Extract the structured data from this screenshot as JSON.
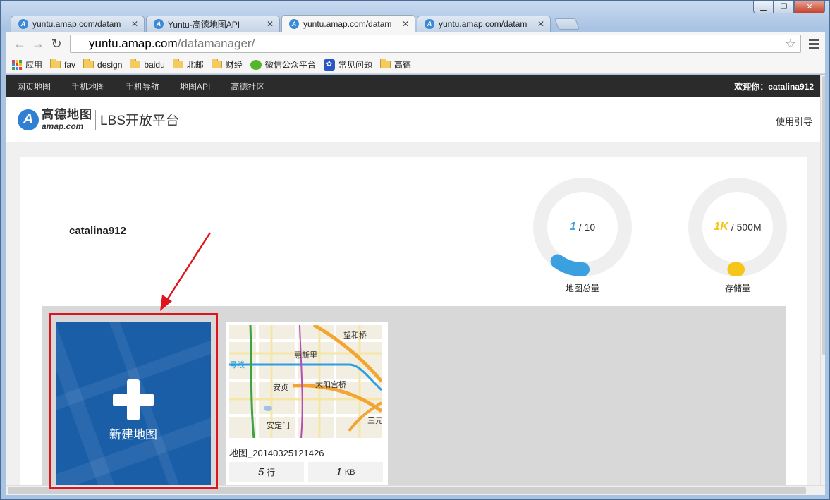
{
  "window": {
    "minimize": "▁",
    "restore": "❐",
    "close": "✕"
  },
  "tabs": [
    {
      "title": "yuntu.amap.com/datam",
      "favicon": "amap-icon"
    },
    {
      "title": "Yuntu-高德地图API",
      "favicon": "amap-icon"
    },
    {
      "title": "yuntu.amap.com/datam",
      "favicon": "amap-icon",
      "active": true
    },
    {
      "title": "yuntu.amap.com/datam",
      "favicon": "amap-icon"
    }
  ],
  "toolbar": {
    "url_host": "yuntu.amap.com",
    "url_path": "/datamanager/"
  },
  "bookmarks": [
    {
      "label": "应用",
      "icon": "apps-grid-icon"
    },
    {
      "label": "fav",
      "icon": "folder-icon"
    },
    {
      "label": "design",
      "icon": "folder-icon"
    },
    {
      "label": "baidu",
      "icon": "folder-icon"
    },
    {
      "label": "北邮",
      "icon": "folder-icon"
    },
    {
      "label": "财经",
      "icon": "folder-icon"
    },
    {
      "label": "微信公众平台",
      "icon": "wechat-icon"
    },
    {
      "label": "常见问题",
      "icon": "baidu-paw-icon"
    },
    {
      "label": "高德",
      "icon": "folder-icon"
    }
  ],
  "topnav": {
    "links": [
      "网页地图",
      "手机地图",
      "手机导航",
      "地图API",
      "高德社区"
    ],
    "welcome": "欢迎你：catalina912"
  },
  "brand": {
    "logo_cn": "高德地图",
    "logo_en": "amap.com",
    "platform": "LBS开放平台",
    "guide": "使用引导"
  },
  "account": {
    "username": "catalina912"
  },
  "quota": {
    "maps": {
      "used": "1",
      "total": "/ 10",
      "label": "地图总量",
      "fraction": 0.1,
      "color": "#3ba0e0"
    },
    "storage": {
      "used": "1K",
      "total": "/ 500M",
      "label": "存储量",
      "fraction": 0.002,
      "color": "#f5c518"
    }
  },
  "new_map": {
    "label": "新建地图"
  },
  "map_cards": [
    {
      "name": "地图_20140325121426",
      "rows": "5",
      "rows_unit": "行",
      "size": "1",
      "size_unit": "KB",
      "thumb_labels": [
        "望和桥",
        "惠新里",
        "号线",
        "安贞",
        "太阳宫桥",
        "安定门",
        "三元"
      ]
    }
  ]
}
